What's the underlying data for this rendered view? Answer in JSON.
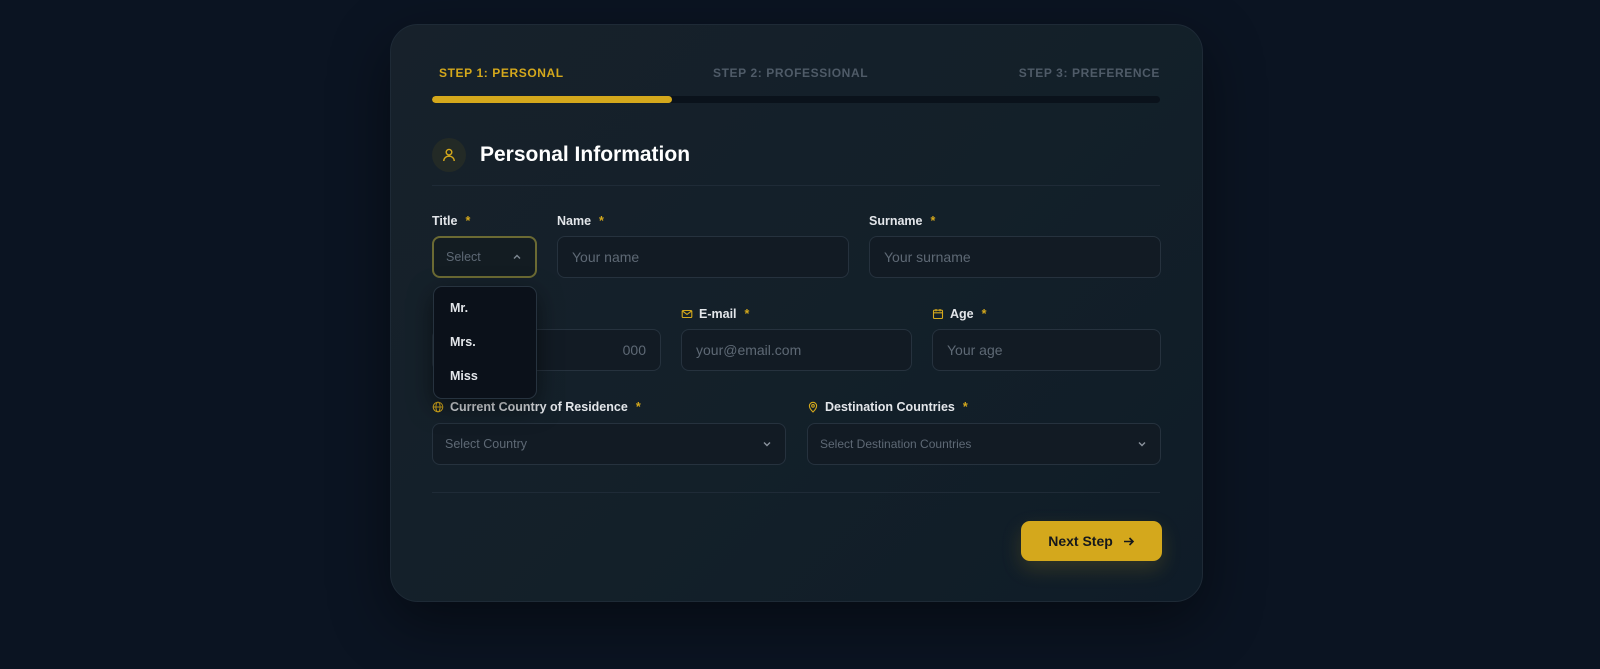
{
  "steps": [
    {
      "label": "STEP 1: PERSONAL",
      "active": true
    },
    {
      "label": "STEP 2: PROFESSIONAL",
      "active": false
    },
    {
      "label": "STEP 3: PREFERENCE",
      "active": false
    }
  ],
  "progress_fraction": 0.33,
  "section": {
    "title": "Personal Information",
    "icon": "user-icon"
  },
  "fields": {
    "title": {
      "label": "Title",
      "required": "*",
      "placeholder": "Select",
      "options": [
        "Mr.",
        "Mrs.",
        "Miss"
      ]
    },
    "name": {
      "label": "Name",
      "required": "*",
      "placeholder": "Your name"
    },
    "surname": {
      "label": "Surname",
      "required": "*",
      "placeholder": "Your surname"
    },
    "phone": {
      "placeholder_visible_fragment": "000"
    },
    "email": {
      "label": "E-mail",
      "required": "*",
      "placeholder": "your@email.com",
      "icon": "mail-icon"
    },
    "age": {
      "label": "Age",
      "required": "*",
      "placeholder": "Your age",
      "icon": "calendar-icon"
    },
    "country": {
      "label": "Current Country of Residence",
      "required": "*",
      "placeholder": "Select Country",
      "icon": "globe-icon"
    },
    "destination": {
      "label": "Destination Countries",
      "required": "*",
      "placeholder": "Select Destination Countries",
      "icon": "map-pin-icon"
    }
  },
  "next_button": {
    "label": "Next Step",
    "icon": "arrow-right-icon"
  },
  "colors": {
    "accent": "#d4a81c",
    "background": "#0b1422",
    "card": "#17212b"
  }
}
